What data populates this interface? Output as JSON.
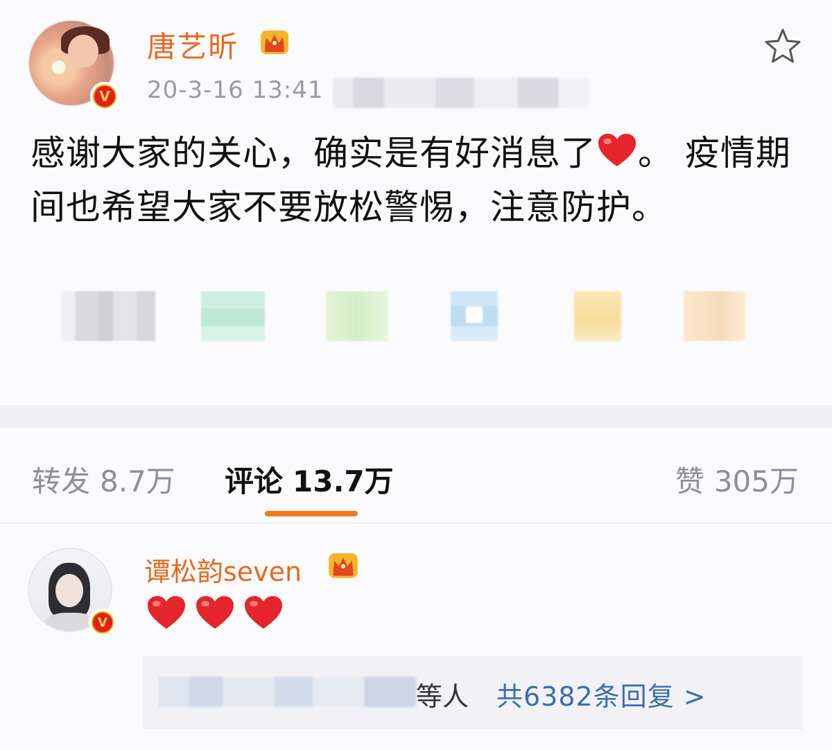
{
  "post": {
    "username": "唐艺昕",
    "timestamp": "20-3-16 13:41",
    "text_part1": "感谢大家的关心，确实是有好消息了",
    "text_part2": "。 疫情期间也希望大家不要放松警惕，注意防护。",
    "inline_emoji": "heart-icon"
  },
  "tabs": {
    "repost": {
      "label": "转发",
      "count": "8.7万"
    },
    "comment": {
      "label": "评论",
      "count": "13.7万"
    },
    "like": {
      "label": "赞",
      "count": "305万"
    },
    "active": "comment"
  },
  "comment": {
    "username": "谭松韵seven",
    "content_emojis": [
      "heart-icon",
      "heart-icon",
      "heart-icon"
    ],
    "reply_others": "等人",
    "reply_count": "共6382条回复 >"
  },
  "colors": {
    "accent_orange": "#e9681f",
    "tab_underline": "#f07d1d",
    "link_blue": "#3a6db0",
    "verified_red": "#e02020",
    "heart_red": "#e4252b"
  }
}
